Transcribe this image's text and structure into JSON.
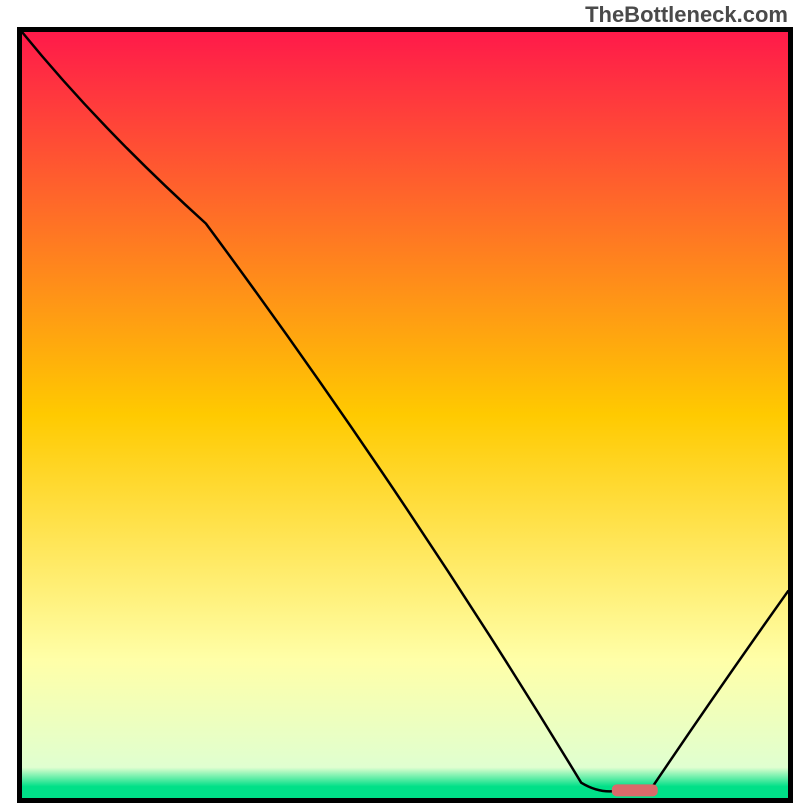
{
  "attribution": "TheBottleneck.com",
  "chart_data": {
    "type": "line",
    "title": "",
    "xlabel": "",
    "ylabel": "",
    "xlim": [
      0,
      100
    ],
    "ylim": [
      0,
      100
    ],
    "grid": false,
    "legend": false,
    "background_gradient": {
      "stops": [
        {
          "offset": 0.0,
          "color": "#ff1a4a"
        },
        {
          "offset": 0.5,
          "color": "#ffca00"
        },
        {
          "offset": 0.82,
          "color": "#ffffa8"
        },
        {
          "offset": 0.96,
          "color": "#e0ffd0"
        },
        {
          "offset": 0.985,
          "color": "#00e088"
        },
        {
          "offset": 1.0,
          "color": "#00e088"
        }
      ]
    },
    "series": [
      {
        "name": "bottleneck-curve",
        "color": "#000000",
        "x": [
          0,
          24,
          73,
          78,
          82,
          100
        ],
        "y": [
          100,
          75,
          2,
          1,
          1,
          27
        ]
      }
    ],
    "marker": {
      "name": "optimal-range",
      "color": "#d96a6a",
      "x_start": 77,
      "x_end": 83,
      "y": 1
    }
  }
}
